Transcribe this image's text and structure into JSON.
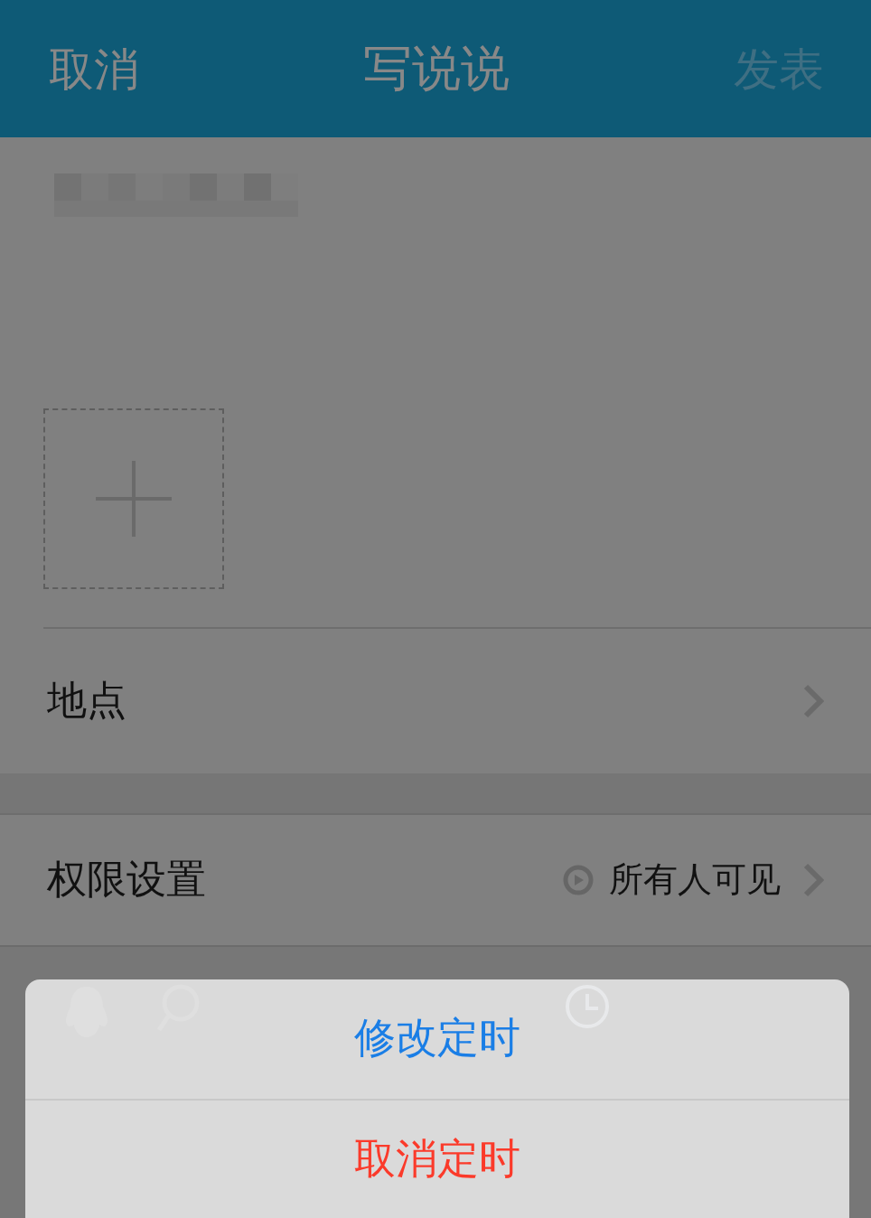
{
  "nav": {
    "cancel": "取消",
    "title": "写说说",
    "publish": {
      "label": "发表",
      "disabled": true
    }
  },
  "rows": [
    {
      "kind": "link",
      "label": "地点"
    },
    {
      "kind": "value",
      "label": "权限设置",
      "value": "所有人可见"
    }
  ],
  "action_sheet": [
    {
      "kind": "default",
      "label": "修改定时"
    },
    {
      "kind": "destructive",
      "label": "取消定时"
    }
  ]
}
